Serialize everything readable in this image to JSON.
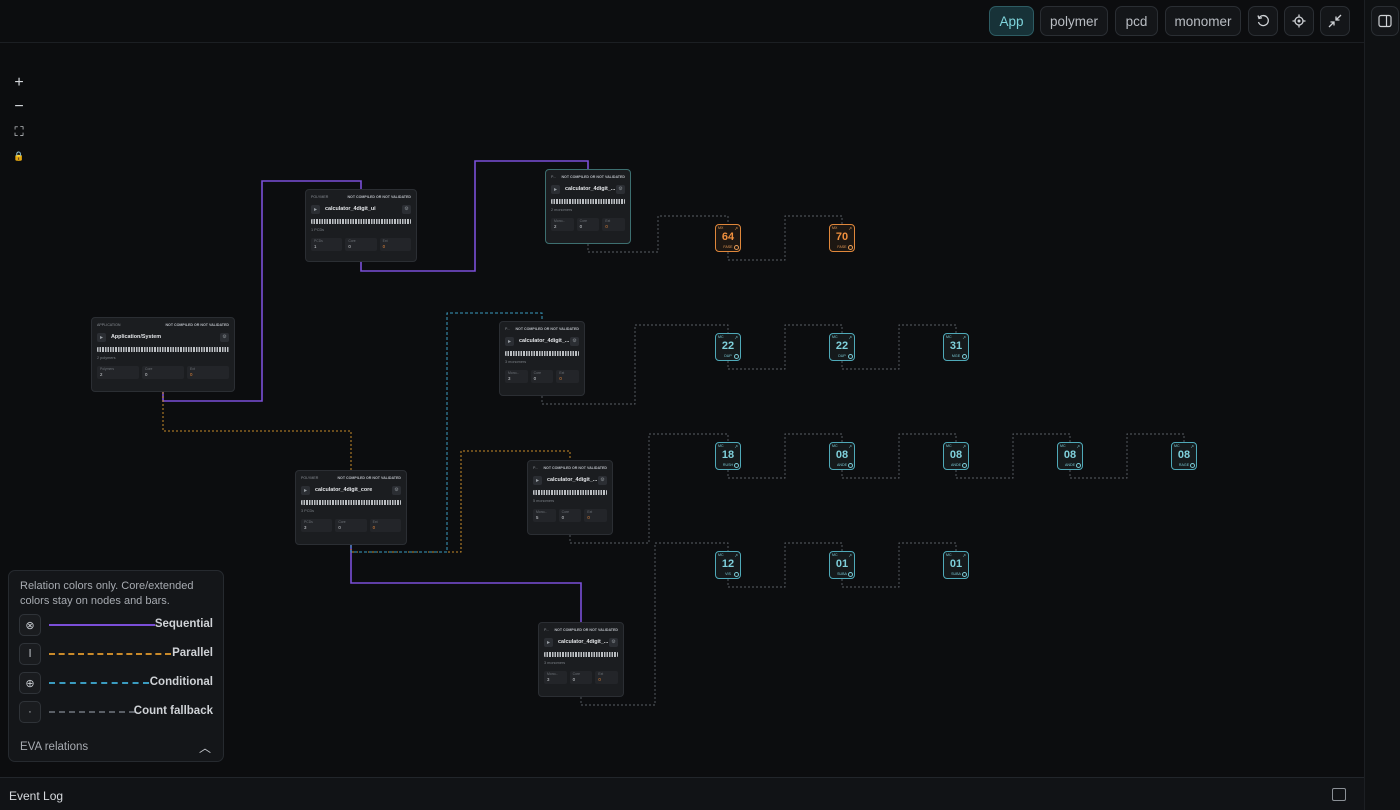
{
  "toolbar": {
    "views": [
      "App",
      "polymer",
      "pcd",
      "monomer"
    ],
    "active_view": "App",
    "icons": [
      "reset-icon",
      "locate-icon",
      "collapse-icon"
    ]
  },
  "zoom_controls": [
    "+",
    "−",
    "⛶",
    "🔒"
  ],
  "cards": [
    {
      "kind": "APPLICATION",
      "status": "NOT COMPILED OR NOT VALIDATED",
      "name": "Application/System",
      "sub": "2 polymers",
      "stats": [
        {
          "k": "Polymers",
          "v": "2"
        },
        {
          "k": "Core",
          "v": "0"
        },
        {
          "k": "Ext",
          "v": "0"
        }
      ]
    },
    {
      "kind": "POLYMER",
      "status": "NOT COMPILED OR NOT VALIDATED",
      "name": "calculator_4digit_ui",
      "sub": "1 PCDs",
      "stats": [
        {
          "k": "PCDs",
          "v": "1"
        },
        {
          "k": "Core",
          "v": "0"
        },
        {
          "k": "Ext",
          "v": "0"
        }
      ]
    },
    {
      "kind": "P...",
      "status": "NOT COMPILED OR NOT VALIDATED",
      "name": "calculator_4digit_...",
      "sub": "2 monomers",
      "stats": [
        {
          "k": "Mono...",
          "v": "2"
        },
        {
          "k": "Core",
          "v": "0"
        },
        {
          "k": "Ext",
          "v": "0"
        }
      ]
    },
    {
      "kind": "P...",
      "status": "NOT COMPILED OR NOT VALIDATED",
      "name": "calculator_4digit_...",
      "sub": "3 monomers",
      "stats": [
        {
          "k": "Mono...",
          "v": "3"
        },
        {
          "k": "Core",
          "v": "0"
        },
        {
          "k": "Ext",
          "v": "0"
        }
      ]
    },
    {
      "kind": "POLYMER",
      "status": "NOT COMPILED OR NOT VALIDATED",
      "name": "calculator_4digit_core",
      "sub": "3 PCDs",
      "stats": [
        {
          "k": "PCDs",
          "v": "3"
        },
        {
          "k": "Core",
          "v": "0"
        },
        {
          "k": "Ext",
          "v": "0"
        }
      ]
    },
    {
      "kind": "P...",
      "status": "NOT COMPILED OR NOT VALIDATED",
      "name": "calculator_4digit_...",
      "sub": "5 monomers",
      "stats": [
        {
          "k": "Mono...",
          "v": "5"
        },
        {
          "k": "Core",
          "v": "0"
        },
        {
          "k": "Ext",
          "v": "0"
        }
      ]
    },
    {
      "kind": "P...",
      "status": "NOT COMPILED OR NOT VALIDATED",
      "name": "calculator_4digit_...",
      "sub": "3 monomers",
      "stats": [
        {
          "k": "Mono...",
          "v": "3"
        },
        {
          "k": "Core",
          "v": "0"
        },
        {
          "k": "Ext",
          "v": "0"
        }
      ]
    }
  ],
  "tiles": [
    {
      "tag": "MX",
      "num": "64",
      "label": "FASE",
      "color": "orange"
    },
    {
      "tag": "MX",
      "num": "70",
      "label": "FASE",
      "color": "orange"
    },
    {
      "tag": "MC",
      "num": "22",
      "label": "DUP",
      "color": "teal"
    },
    {
      "tag": "MC",
      "num": "22",
      "label": "DUP",
      "color": "teal"
    },
    {
      "tag": "MC",
      "num": "31",
      "label": "MGE",
      "color": "teal"
    },
    {
      "tag": "MC",
      "num": "18",
      "label": "RUSH",
      "color": "teal"
    },
    {
      "tag": "MC",
      "num": "08",
      "label": "ANDE",
      "color": "teal"
    },
    {
      "tag": "MC",
      "num": "08",
      "label": "ANDE",
      "color": "teal"
    },
    {
      "tag": "MC",
      "num": "08",
      "label": "ANDE",
      "color": "teal"
    },
    {
      "tag": "MC",
      "num": "08",
      "label": "RAGE",
      "color": "teal"
    },
    {
      "tag": "MC",
      "num": "12",
      "label": "VIS",
      "color": "teal"
    },
    {
      "tag": "MC",
      "num": "01",
      "label": "SUBA",
      "color": "teal"
    },
    {
      "tag": "MC",
      "num": "01",
      "label": "SUBA",
      "color": "teal"
    }
  ],
  "legend": {
    "intro": "Relation colors only. Core/extended colors stay on nodes and bars.",
    "items": [
      {
        "name": "Sequential",
        "color": "#7b4fd8",
        "style": "solid",
        "icon": "⊗"
      },
      {
        "name": "Parallel",
        "color": "#c98a2a",
        "style": "dashed",
        "icon": "ǀ"
      },
      {
        "name": "Conditional",
        "color": "#3a9bbf",
        "style": "dashed",
        "icon": "⊕"
      },
      {
        "name": "Count fallback",
        "color": "#5a5f66",
        "style": "dashed",
        "icon": "·"
      }
    ],
    "footer": "EVA relations"
  },
  "event_log": {
    "title": "Event Log"
  },
  "colors": {
    "sequential": "#7b4fd8",
    "parallel": "#c98a2a",
    "conditional": "#3a9bbf",
    "fallback": "#5a5f66",
    "accent": "#7fd5dc"
  }
}
